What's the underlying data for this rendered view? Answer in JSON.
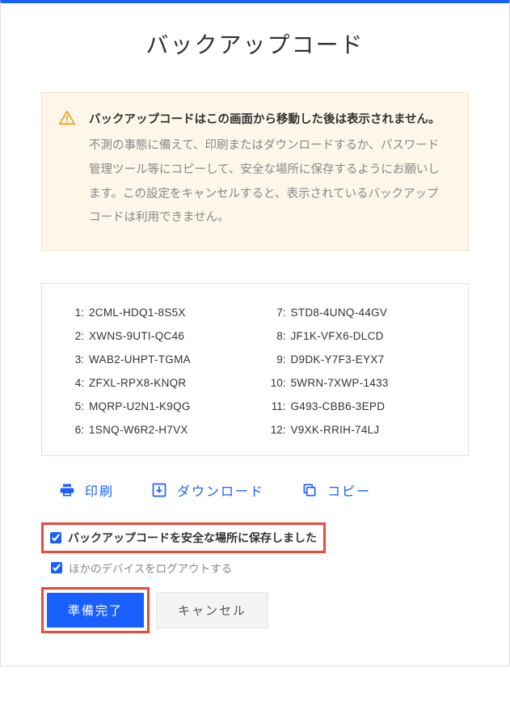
{
  "title": "バックアップコード",
  "warning": {
    "heading": "バックアップコードはこの画面から移動した後は表示されません。",
    "body": "不測の事態に備えて、印刷またはダウンロードするか、パスワード管理ツール等にコピーして、安全な場所に保存するようにお願いします。この設定をキャンセルすると、表示されているバックアップコードは利用できません。"
  },
  "codes": [
    {
      "n": "1:",
      "v": "2CML-HDQ1-8S5X"
    },
    {
      "n": "2:",
      "v": "XWNS-9UTI-QC46"
    },
    {
      "n": "3:",
      "v": "WAB2-UHPT-TGMA"
    },
    {
      "n": "4:",
      "v": "ZFXL-RPX8-KNQR"
    },
    {
      "n": "5:",
      "v": "MQRP-U2N1-K9QG"
    },
    {
      "n": "6:",
      "v": "1SNQ-W6R2-H7VX"
    },
    {
      "n": "7:",
      "v": "STD8-4UNQ-44GV"
    },
    {
      "n": "8:",
      "v": "JF1K-VFX6-DLCD"
    },
    {
      "n": "9:",
      "v": "D9DK-Y7F3-EYX7"
    },
    {
      "n": "10:",
      "v": "5WRN-7XWP-1433"
    },
    {
      "n": "11:",
      "v": "G493-CBB6-3EPD"
    },
    {
      "n": "12:",
      "v": "V9XK-RRIH-74LJ"
    }
  ],
  "actions": {
    "print": "印刷",
    "download": "ダウンロード",
    "copy": "コピー"
  },
  "checks": {
    "saved": "バックアップコードを安全な場所に保存しました",
    "logout": "ほかのデバイスをログアウトする"
  },
  "buttons": {
    "ready": "準備完了",
    "cancel": "キャンセル"
  }
}
